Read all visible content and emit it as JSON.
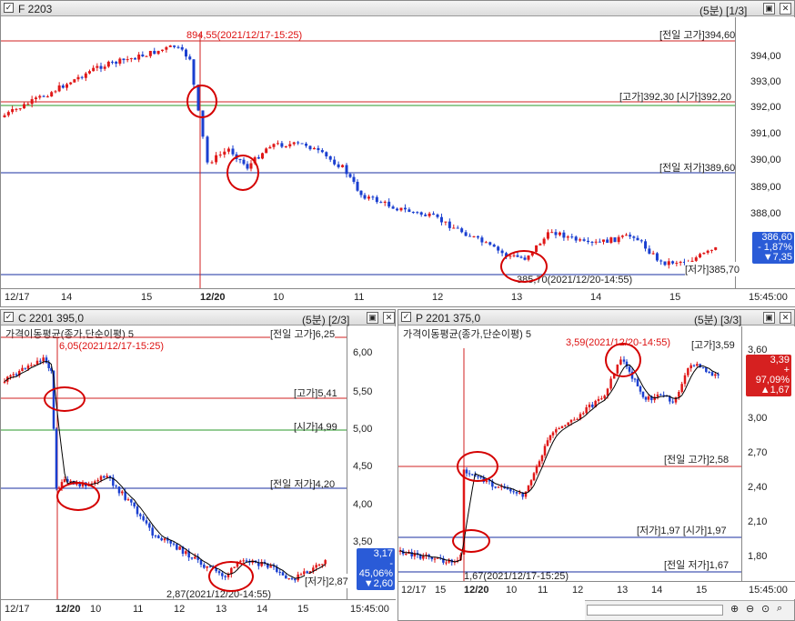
{
  "top": {
    "title": "F 2203",
    "period": "(5분) [1/3]",
    "yticks": [
      "394,00",
      "393,00",
      "392,00",
      "391,00",
      "390,00",
      "389,00",
      "388,00"
    ],
    "xticks": [
      "12/17",
      "14",
      "15",
      "12/20",
      "10",
      "11",
      "12",
      "13",
      "14",
      "15",
      "15:45:00"
    ],
    "hi_label": "[전일 고가]394,60",
    "open_label": "[고가]392,30 [시가]392,20",
    "lo_label": "[전일 저가]389,60",
    "day_low_label": "[저가]385,70",
    "max_ann": "894,55(2021/12/17-15:25)",
    "min_ann": "385,70(2021/12/20-14:55)",
    "price": "386,60",
    "pct": "- 1,87%",
    "chg": "▼7,35",
    "price_color": "#2a5bd7"
  },
  "left": {
    "title": "C 2201 395,0",
    "period": "(5분) [2/3]",
    "indicator": "가격이동평균(종가,단순이평) 5",
    "yticks": [
      "6,00",
      "5,50",
      "5,00",
      "4,50",
      "4,00",
      "3,50"
    ],
    "xticks": [
      "12/17",
      "12/20",
      "10",
      "11",
      "12",
      "13",
      "14",
      "15",
      "15:45:00"
    ],
    "hi_label": "[전일 고가]6,25",
    "hi2_label": "[고가]5,41",
    "open_label": "[시가]4,99",
    "lo_label": "[전일 저가]4,20",
    "day_low_label": "[저가]2,87",
    "max_ann": "6,05(2021/12/17-15:25)",
    "min_ann": "2,87(2021/12/20-14:55)",
    "price": "3,17",
    "pct": "- 45,06%",
    "chg": "▼2,60",
    "price_color": "#2a5bd7"
  },
  "right": {
    "title": "P 2201 375,0",
    "period": "(5분) [3/3]",
    "indicator": "가격이동평균(종가,단순이평) 5",
    "yticks": [
      "3,60",
      "3,00",
      "2,70",
      "2,40",
      "2,10",
      "1,80"
    ],
    "xticks": [
      "12/17",
      "15",
      "12/20",
      "10",
      "11",
      "12",
      "13",
      "14",
      "15",
      "15:45:00"
    ],
    "hi_label": "[고가]3,59",
    "hi2_label": "[전일 고가]2,58",
    "open_label": "[저가]1,97 [시가]1,97",
    "lo_label": "[전일 저가]1,67",
    "max_ann": "3,59(2021/12/20-14:55)",
    "min_ann": "1,67(2021/12/17-15:25)",
    "price": "3,39",
    "pct": "+ 97,09%",
    "chg": "▲1,67",
    "price_color": "#d62020"
  }
}
